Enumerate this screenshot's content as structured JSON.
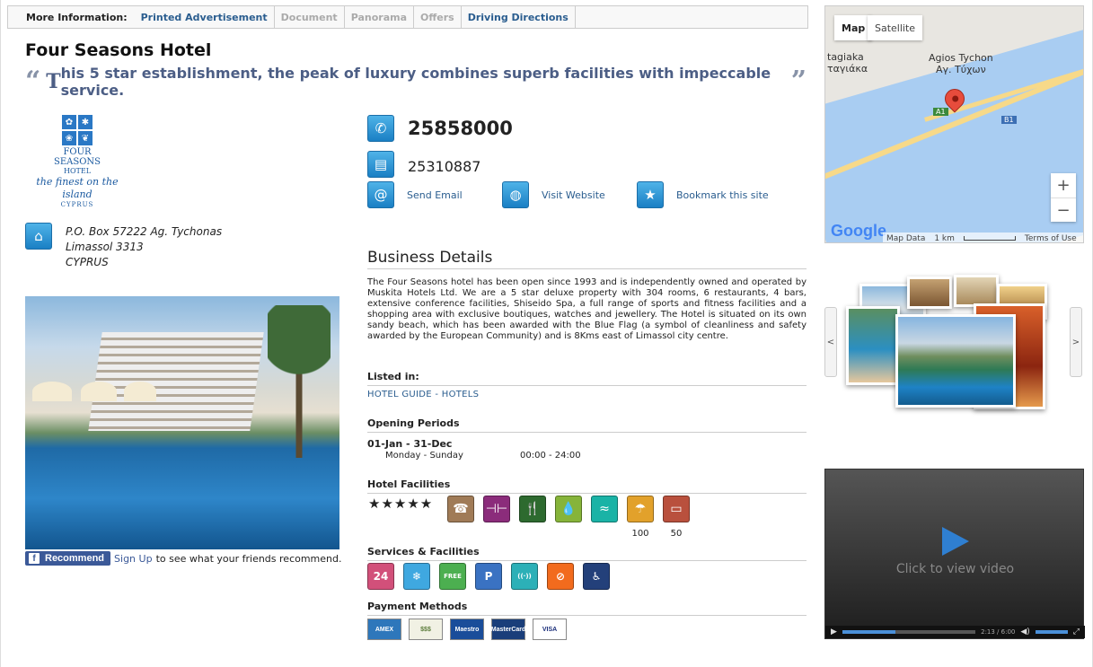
{
  "infobar": {
    "label": "More Information:",
    "tabs": [
      {
        "label": "Printed Advertisement",
        "state": "enabled"
      },
      {
        "label": "Document",
        "state": "disabled"
      },
      {
        "label": "Panorama",
        "state": "disabled"
      },
      {
        "label": "Offers",
        "state": "disabled"
      },
      {
        "label": "Driving Directions",
        "state": "enabled"
      }
    ]
  },
  "business": {
    "name": "Four Seasons Hotel",
    "slogan_open": "“",
    "slogan_first": "T",
    "slogan_rest": "his 5 star establishment, the peak of luxury combines superb facilities with impeccable service.",
    "slogan_close": "”"
  },
  "logo": {
    "line1": "FOUR",
    "line2": "SEASONS",
    "line3": "HOTEL",
    "tagline": "the finest on the island",
    "country": "CYPRUS"
  },
  "address": {
    "line1": "P.O. Box 57222 Ag. Tychonas",
    "line2": "Limassol 3313",
    "line3": "CYPRUS"
  },
  "contact": {
    "phone": "25858000",
    "fax": "25310887",
    "email_label": "Send Email",
    "website_label": "Visit Website",
    "bookmark_label": "Bookmark this site"
  },
  "recommend": {
    "button": "Recommend",
    "signup": "Sign Up",
    "text": "to see what your friends recommend."
  },
  "details": {
    "heading": "Business Details",
    "description": "The Four Seasons hotel has been open since 1993 and is independently owned and operated by Muskita Hotels Ltd. We are a 5 star deluxe property with 304 rooms, 6 restaurants, 4 bars, extensive conference facilities, Shiseido Spa, a full range of sports and fitness facilities and a shopping area with exclusive boutiques, watches and jewellery. The Hotel is situated on its own sandy beach, which has been awarded with the Blue Flag (a symbol of cleanliness and safety awarded by the European Community) and is 8Kms east of Limassol city centre.",
    "listed_heading": "Listed in:",
    "listed_value": "HOTEL GUIDE - HOTELS",
    "opening_heading": "Opening Periods",
    "opening_range": "01-Jan - 31-Dec",
    "opening_days": "Monday - Sunday",
    "opening_hours": "00:00 - 24:00",
    "facilities_heading": "Hotel Facilities",
    "stars": "★★★★★",
    "facility_icons": [
      {
        "icon": "conference-icon",
        "glyph": "☎",
        "color": "#a07b57"
      },
      {
        "icon": "gym-icon",
        "glyph": "⊣⊢",
        "color": "#8b2c7b"
      },
      {
        "icon": "restaurant-icon",
        "glyph": "🍴",
        "color": "#2d6a2f"
      },
      {
        "icon": "spa-icon",
        "glyph": "💧",
        "color": "#86b43a"
      },
      {
        "icon": "pool-icon",
        "glyph": "≈",
        "color": "#1ab3a6"
      },
      {
        "icon": "beach-icon",
        "glyph": "☂",
        "color": "#e2a12b"
      },
      {
        "icon": "bed-icon",
        "glyph": "▭",
        "color": "#b9503d"
      }
    ],
    "beach_count": "100",
    "room_count": "50",
    "services_heading": "Services & Facilities",
    "service_icons": [
      {
        "icon": "24h-icon",
        "glyph": "24",
        "color": "#d2507a"
      },
      {
        "icon": "air-conditioning-icon",
        "glyph": "❄",
        "color": "#3fa8e0"
      },
      {
        "icon": "free-delivery-icon",
        "glyph": "FREE",
        "color": "#4caf50"
      },
      {
        "icon": "parking-icon",
        "glyph": "P",
        "color": "#3a72c2"
      },
      {
        "icon": "wifi-icon",
        "glyph": "((·))",
        "color": "#2cb0b7"
      },
      {
        "icon": "no-smoking-icon",
        "glyph": "⊘",
        "color": "#f26b1d"
      },
      {
        "icon": "wheelchair-icon",
        "glyph": "♿",
        "color": "#23407a"
      }
    ],
    "payment_heading": "Payment Methods",
    "payments": [
      {
        "icon": "amex-icon",
        "label": "AMEX"
      },
      {
        "icon": "cash-icon",
        "label": "$$$"
      },
      {
        "icon": "maestro-icon",
        "label": "Maestro"
      },
      {
        "icon": "mastercard-icon",
        "label": "MasterCard"
      },
      {
        "icon": "visa-icon",
        "label": "VISA"
      }
    ]
  },
  "map": {
    "tab_map": "Map",
    "tab_satellite": "Satellite",
    "place_left1": "tagiaka",
    "place_left2": "ταγιάκα",
    "place_right1": "Agios Tychon",
    "place_right2": "Αγ. Τύχων",
    "highway_a1": "A1",
    "highway_b1": "B1",
    "zoom_in": "+",
    "zoom_out": "−",
    "brand": "Google",
    "footer_data": "Map Data",
    "footer_scale": "1 km",
    "footer_terms": "Terms of Use"
  },
  "gallery": {
    "prev": "<",
    "next": ">"
  },
  "video": {
    "cta": "Click to view video",
    "time": "2:13 / 6:00",
    "progress": 0.4
  }
}
